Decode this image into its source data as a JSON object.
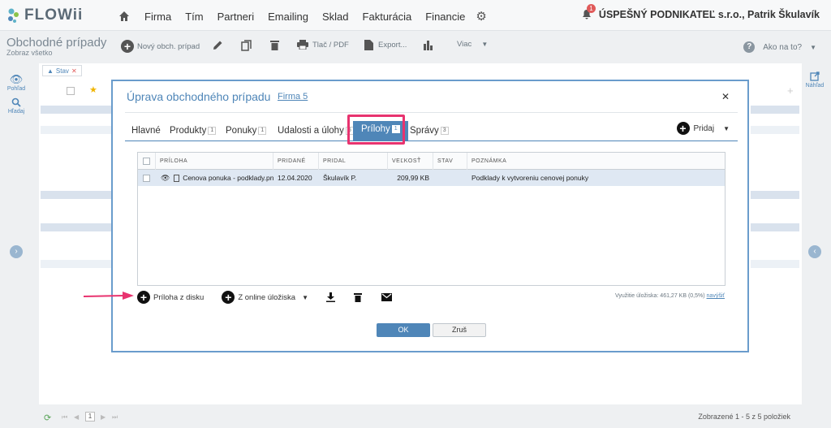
{
  "app": {
    "logo_text": "FLOWii",
    "nav": [
      "Firma",
      "Tím",
      "Partneri",
      "Emailing",
      "Sklad",
      "Fakturácia",
      "Financie"
    ],
    "notification_count": "1",
    "account_name": "ÚSPEŠNÝ PODNIKATEĽ s.r.o., Patrik Škulavík"
  },
  "toolbar": {
    "page_title": "Obchodné prípady",
    "page_subtitle": "Zobraz všetko",
    "new_case": "Nový obch. prípad",
    "print": "Tlač / PDF",
    "export": "Export...",
    "more": "Viac",
    "help": "Ako na to?"
  },
  "side": {
    "view": "Pohľad",
    "search": "Hľadaj",
    "preview": "Náhľad"
  },
  "filter": {
    "label": "Stav"
  },
  "footer": {
    "page": "1",
    "summary": "Zobrazené 1 - 5 z 5 položiek"
  },
  "modal": {
    "title": "Úprava obchodného prípadu",
    "company_link": "Firma 5",
    "add": "Pridaj",
    "tabs": [
      {
        "label": "Hlavné",
        "count": ""
      },
      {
        "label": "Produkty",
        "count": "1"
      },
      {
        "label": "Ponuky",
        "count": "1"
      },
      {
        "label": "Udalosti a úlohy",
        "count": "5"
      },
      {
        "label": "Prílohy",
        "count": "1"
      },
      {
        "label": "Správy",
        "count": "3"
      }
    ],
    "columns": [
      "PRÍLOHA",
      "PRIDANÉ",
      "PRIDAL",
      "VEĽKOSŤ",
      "STAV",
      "POZNÁMKA"
    ],
    "rows": [
      {
        "file": "Cenova ponuka - podklady.png",
        "added": "12.04.2020",
        "added_by": "Škulavík P.",
        "size": "209,99 KB",
        "state": "",
        "note": "Podklady k vytvoreniu cenovej ponuky"
      }
    ],
    "actions": {
      "from_disk": "Príloha z disku",
      "from_cloud": "Z online úložiska"
    },
    "storage_text": "Využitie úložiska: 461,27 KB (0,5%)",
    "storage_link": "navýšiť",
    "ok": "OK",
    "cancel": "Zruš"
  },
  "colors": {
    "accent": "#4f86b8",
    "highlight": "#e8336f"
  }
}
